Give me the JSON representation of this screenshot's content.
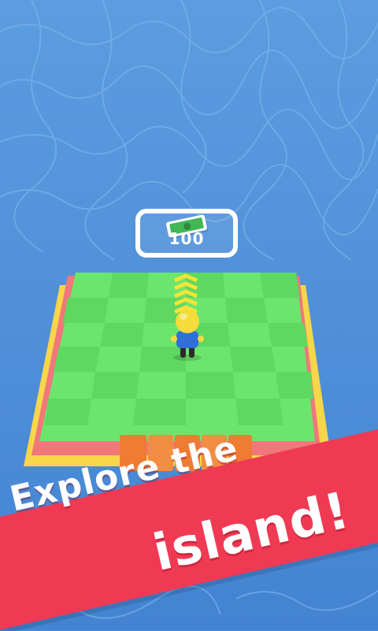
{
  "scene": {
    "water_color": "#4a8fd9",
    "island_colors": {
      "grass_light": "#6ce56c",
      "grass_dark": "#5fd85f",
      "border_red": "#f0777b",
      "border_yellow": "#f7d64a",
      "bridge_orange": "#f07b33"
    }
  },
  "purchase_pad": {
    "icon": "cash-icon",
    "price": "100"
  },
  "banner": {
    "line1": "Explore the",
    "line2": "island!",
    "color": "#f03a54"
  }
}
